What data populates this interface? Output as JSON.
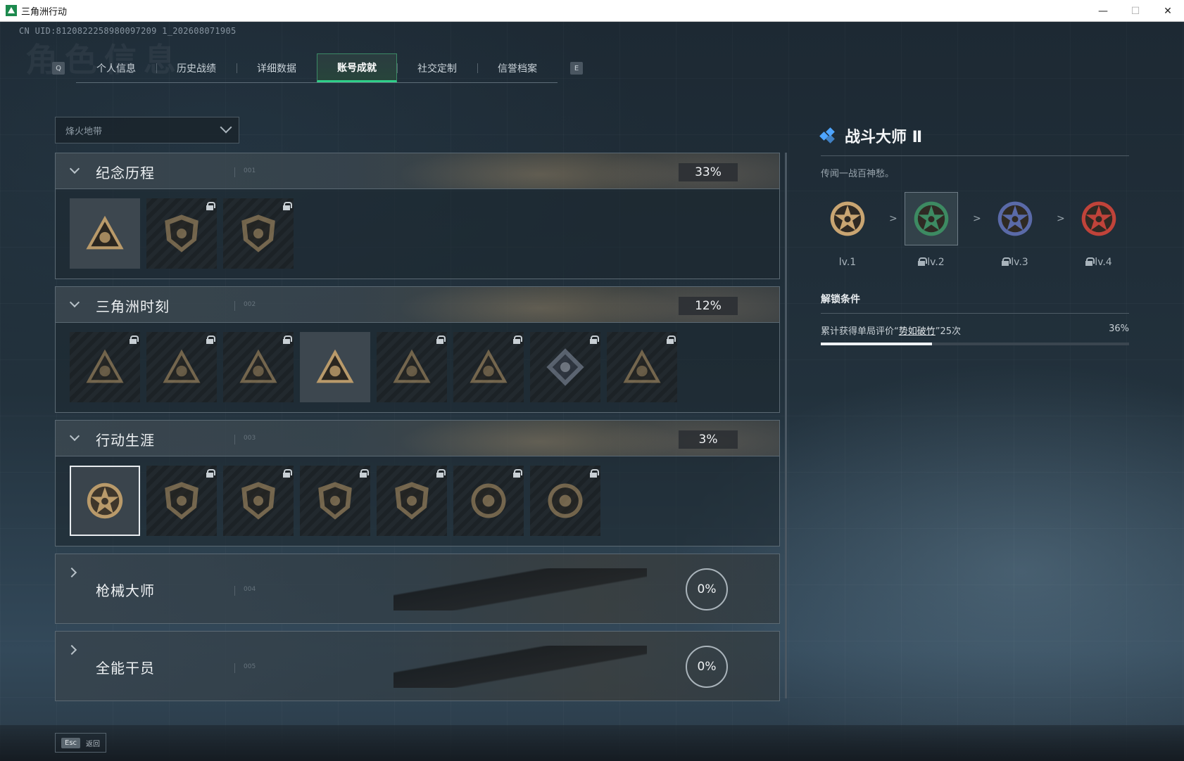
{
  "window": {
    "title": "三角洲行动",
    "minimize": "—",
    "maximize": "☐",
    "close": "✕"
  },
  "uid": "CN UID:8120822258980097209 1_202608071905",
  "background_word": "角色信息",
  "tabs": {
    "left_key": "Q",
    "right_key": "E",
    "items": [
      "个人信息",
      "历史战绩",
      "详细数据",
      "账号成就",
      "社交定制",
      "信誉档案"
    ],
    "active": "账号成就"
  },
  "filter": {
    "selected": "烽火地带"
  },
  "sections": [
    {
      "title": "纪念历程",
      "index": "001",
      "percent": "33%",
      "expanded": true,
      "badges": [
        {
          "icon": "triangle-mountain-badge",
          "locked": false
        },
        {
          "icon": "helicopter-badge",
          "locked": true
        },
        {
          "icon": "shield-emblem-badge",
          "locked": true
        }
      ]
    },
    {
      "title": "三角洲时刻",
      "index": "002",
      "percent": "12%",
      "expanded": true,
      "badges": [
        {
          "icon": "triangle-figure-badge",
          "locked": true
        },
        {
          "icon": "triangle-runner-badge",
          "locked": true
        },
        {
          "icon": "triangle-hands-badge",
          "locked": true
        },
        {
          "icon": "triangle-squad-badge",
          "locked": false
        },
        {
          "icon": "triangle-eagle-badge",
          "locked": true
        },
        {
          "icon": "triangle-fish-badge",
          "locked": true
        },
        {
          "icon": "diamond-crest-badge",
          "locked": true
        },
        {
          "icon": "triangle-skull-badge",
          "locked": true
        }
      ]
    },
    {
      "title": "行动生涯",
      "index": "003",
      "percent": "3%",
      "expanded": true,
      "badges": [
        {
          "icon": "star-skull-badge",
          "locked": false,
          "selected": true
        },
        {
          "icon": "winged-shield-badge",
          "locked": true
        },
        {
          "icon": "split-shield-badge",
          "locked": true
        },
        {
          "icon": "hex-shield-badge",
          "locked": true
        },
        {
          "icon": "round-emblem-badge",
          "locked": true
        },
        {
          "icon": "crosshair-skull-badge",
          "locked": true
        },
        {
          "icon": "eye-ring-badge",
          "locked": true
        }
      ]
    },
    {
      "title": "枪械大师",
      "index": "004",
      "percent": "0%",
      "expanded": false
    },
    {
      "title": "全能干员",
      "index": "005",
      "percent": "0%",
      "expanded": false
    }
  ],
  "detail": {
    "title": "战斗大师 Ⅱ",
    "description": "传闻一战百神愁。",
    "levels": [
      {
        "label": "lv.1",
        "locked": false,
        "color": "#c9a572"
      },
      {
        "label": "lv.2",
        "locked": true,
        "color": "#3d8a62",
        "current": true
      },
      {
        "label": "lv.3",
        "locked": true,
        "color": "#5a6aa8"
      },
      {
        "label": "lv.4",
        "locked": true,
        "color": "#c0433a"
      }
    ],
    "separator": ">",
    "condition_title": "解锁条件",
    "condition_prefix": "累计获得单局评价“",
    "condition_highlight": "势如破竹",
    "condition_suffix": "”25次",
    "condition_percent": "36%",
    "progress": 0.36
  },
  "bottom": {
    "esc_key": "Esc",
    "back_label": "返回"
  },
  "colors": {
    "accent_green": "#2fcf8a",
    "badge_gold": "#b99a6a",
    "diamond_blue": "#4ea5ff"
  }
}
